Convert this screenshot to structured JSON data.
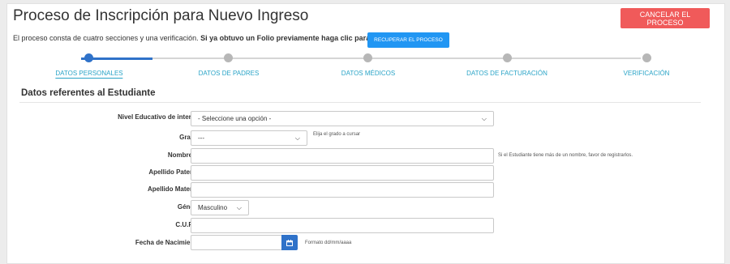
{
  "header": {
    "title": "Proceso de Inscripción para Nuevo Ingreso",
    "cancel_label": "CANCELAR EL PROCESO"
  },
  "intro": {
    "text": "El proceso consta de cuatro secciones y una verificación.",
    "bold_text": "Si ya obtuvo un Folio previamente haga clic para",
    "recover_label": "RECUPERAR EL PROCESO"
  },
  "steps": [
    {
      "label": "DATOS PERSONALES",
      "active": true
    },
    {
      "label": "DATOS DE PADRES",
      "active": false
    },
    {
      "label": "DATOS MÉDICOS",
      "active": false
    },
    {
      "label": "DATOS DE FACTURACIÓN",
      "active": false
    },
    {
      "label": "VERIFICACIÓN",
      "active": false
    }
  ],
  "section_title": "Datos referentes al Estudiante",
  "form": {
    "nivel": {
      "label": "Nivel Educativo de interés *",
      "value": "- Seleccione una opción -"
    },
    "grado": {
      "label": "Grado *",
      "value": "---",
      "help": "Elija el grado a cursar"
    },
    "nombre": {
      "label": "Nombre(s)*",
      "value": "",
      "help": "Si el Estudiante tiene más de un nombre, favor de registrarlos."
    },
    "apellido_paterno": {
      "label": "Apellido Paterno*",
      "value": ""
    },
    "apellido_materno": {
      "label": "Apellido Materno*",
      "value": ""
    },
    "genero": {
      "label": "Género*",
      "value": "Masculino"
    },
    "curp": {
      "label": "C.U.R.P.*",
      "value": ""
    },
    "fecha_nacimiento": {
      "label": "Fecha de Nacimiento*",
      "value": "",
      "help": "Formato dd/mm/aaaa"
    }
  },
  "colors": {
    "accent": "#2f72c9",
    "cancel": "#f05a5a",
    "recover": "#2196f3",
    "step_text": "#2aa4c7"
  },
  "icons": {
    "calendar": "calendar-icon",
    "chevron": "chevron-down-icon"
  }
}
